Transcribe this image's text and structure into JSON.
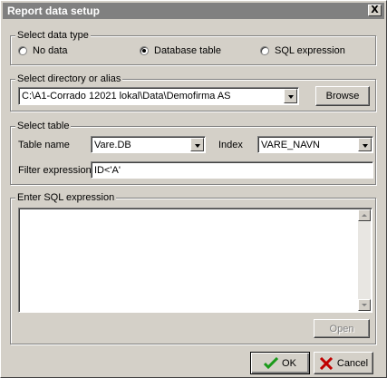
{
  "window": {
    "title": "Report data setup",
    "close_glyph": "X"
  },
  "data_type": {
    "legend": "Select data type",
    "options": [
      {
        "label": "No data",
        "checked": false
      },
      {
        "label": "Database table",
        "checked": true
      },
      {
        "label": "SQL expression",
        "checked": false
      }
    ]
  },
  "directory": {
    "legend": "Select directory or alias",
    "value": "C:\\A1-Corrado 12021 lokal\\Data\\Demofirma AS",
    "browse_label": "Browse"
  },
  "table": {
    "legend": "Select table",
    "table_name_label": "Table name",
    "table_name_value": "Vare.DB",
    "index_label": "Index",
    "index_value": "VARE_NAVN",
    "filter_label": "Filter expression",
    "filter_value": "ID<'A'"
  },
  "sql": {
    "legend": "Enter SQL expression",
    "value": "",
    "open_label": "Open"
  },
  "buttons": {
    "ok_label": "OK",
    "cancel_label": "Cancel"
  },
  "icons": {
    "ok": "green-checkmark-icon",
    "cancel": "red-x-icon",
    "close": "close-icon",
    "dropdown": "chevron-down-icon"
  },
  "colors": {
    "titlebar": "#808080",
    "face": "#d4d0c8",
    "ok_icon": "#1a9a1a",
    "cancel_icon": "#c00000"
  }
}
